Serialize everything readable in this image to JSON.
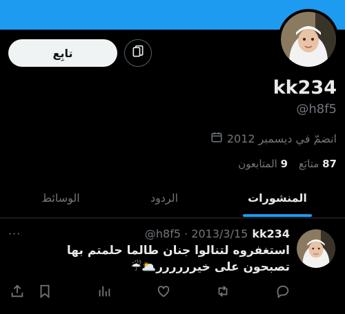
{
  "profile": {
    "name": "kk234",
    "handle": "@h8f5",
    "joined": "انضمّ في ديسمبر 2012",
    "following_count": "87",
    "following_label": "متابَع",
    "followers_count": "9",
    "followers_label": "المتابعون",
    "follow_button": "تابِع"
  },
  "tabs": [
    {
      "label": "المنشورات",
      "active": true
    },
    {
      "label": "الردود",
      "active": false
    },
    {
      "label": "الوسائط",
      "active": false
    }
  ],
  "tweet": {
    "name": "kk234",
    "meta": "@h8f5 · 2013/3/15",
    "line1": "استغفروه لتنالوا جنان طالما حلمتم بها",
    "line2": "تصبحون على خيرررررر🌥️☔",
    "more": "···"
  },
  "colors": {
    "accent": "#1d9bf0",
    "background": "#000000",
    "text": "#e7e9ea",
    "muted": "#71767b"
  },
  "icons": [
    "calendar-icon",
    "message-icon",
    "reply-icon",
    "retweet-icon",
    "like-icon",
    "views-icon",
    "bookmark-icon",
    "share-icon"
  ]
}
